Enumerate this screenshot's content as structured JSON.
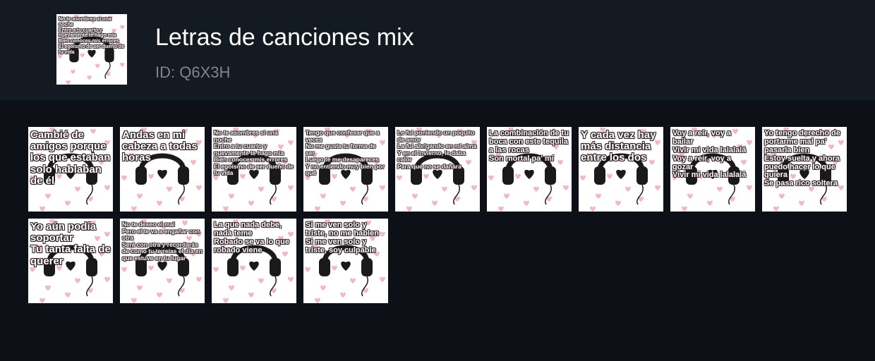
{
  "pack": {
    "title": "Letras de canciones mix",
    "id_label": "ID: Q6X3H",
    "icon_text": "No te asombres si una noche\nEntro a tu cuarto y nuevamente te hago mía\nBien conoces mis errores\nEl egoísmo de ser dueño de tu vida"
  },
  "colors": {
    "header_bg": "#131a22",
    "page_bg": "#0d1117",
    "sticker_bg": "#ffffff",
    "heart": "#f3b6c6",
    "headphones": "#1a1a1a"
  },
  "stickers": [
    {
      "text": "Cambié de amigos porque los que estaban solo hablaban de él",
      "size": "big"
    },
    {
      "text": "Andas en mi cabeza a todas horas",
      "size": "big"
    },
    {
      "text": "No te asombres si una noche\nEntro a tu cuarto y nuevamente te hago mía\nBien conoces mis errores\nEl egoísmo de ser dueño de tu vida",
      "size": "small"
    },
    {
      "text": "Tengo que confesar que a veces\nNo me gusta tu forma de ser\nLuego te me desapareces\nY no entiendo muy bien por qué",
      "size": "small"
    },
    {
      "text": "Le fui poniendo un poquito de amor\nLa fui abrigando en mi alma\nY en el invierno, le daba calor\nPara que no se dañara",
      "size": "small"
    },
    {
      "text": "La combinación de tu boca con este tequila a las rocas\nSon mortal pa' mí",
      "size": "mid"
    },
    {
      "text": "Y cada vez hay más distancia entre los dos",
      "size": "big"
    },
    {
      "text": "Voy a reír, voy a bailar\nVivir mi vida lalalalá\nVoy a reír, voy a gozar\nVivir mi vida lalalalá",
      "size": "mid"
    },
    {
      "text": "Yo tengo derecho de portarme mal pa' pasarla bien\nEstoy suelta y ahora puedo hacer lo que quiera\nSe pasa rico soltera",
      "size": "mid"
    },
    {
      "text": "Yo aún podía soportar\nTu tanta falta de querer",
      "size": "big"
    },
    {
      "text": "No te deseo el mal\nPero el te va a engañar con otra\nSerá con otra y recordarás de como tu te reías el día en que estuve en tu lugar",
      "size": "small"
    },
    {
      "text": "La que nada debe, nada teme\nRobado se va lo que robado viene",
      "size": "mid"
    },
    {
      "text": "Si me ven solo y triste, no me hablen\nSi me ven solo y triste, soy culpable",
      "size": "mid"
    }
  ]
}
